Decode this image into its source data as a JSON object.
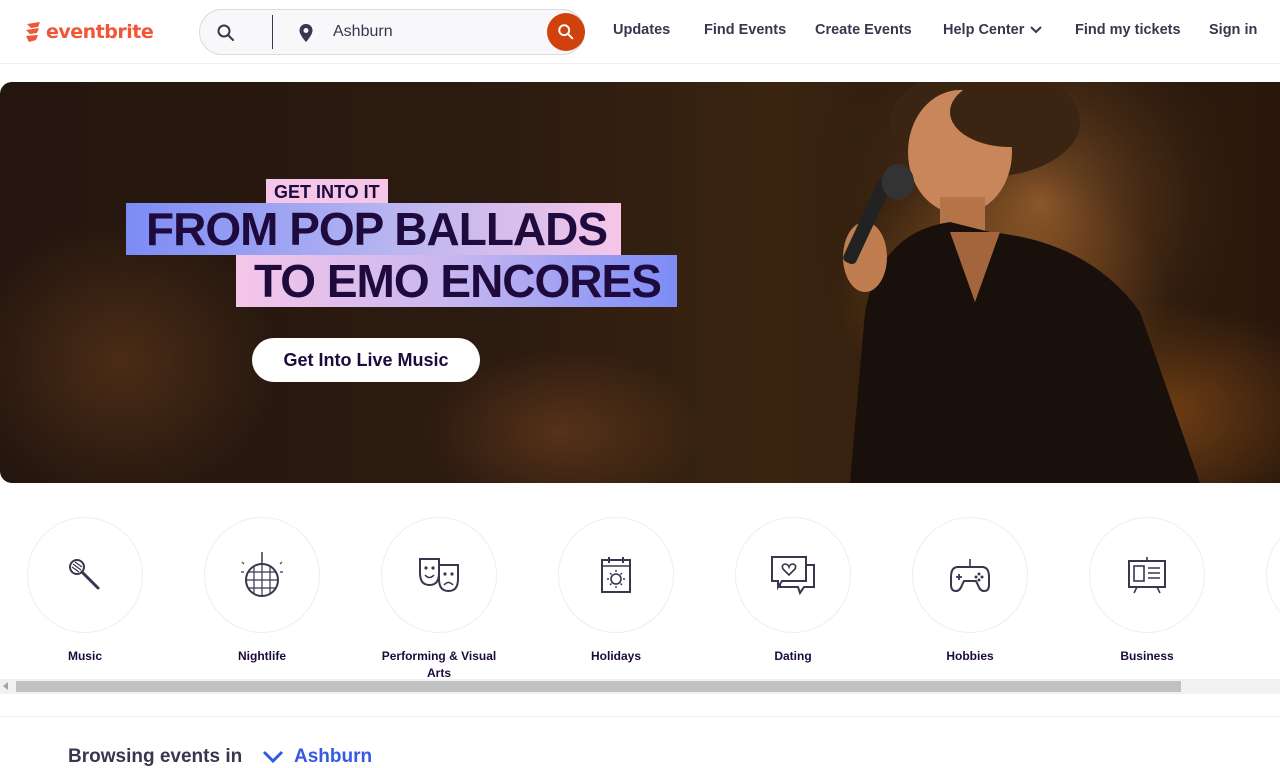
{
  "brand": {
    "name": "eventbrite",
    "color": "#f05537"
  },
  "search": {
    "location": "Ashburn",
    "icon": "search-icon",
    "pin_icon": "location-pin-icon"
  },
  "nav": {
    "updates": "Updates",
    "find_events": "Find Events",
    "create_events": "Create Events",
    "help_center": "Help Center",
    "find_tickets": "Find my tickets",
    "sign_in": "Sign in"
  },
  "hero": {
    "tag": "GET INTO IT",
    "line1": "FROM POP BALLADS",
    "line2": "TO EMO ENCORES",
    "cta": "Get Into Live Music"
  },
  "categories": [
    {
      "label": "Music",
      "icon": "microphone-icon"
    },
    {
      "label": "Nightlife",
      "icon": "disco-ball-icon"
    },
    {
      "label": "Performing & Visual Arts",
      "icon": "theater-masks-icon"
    },
    {
      "label": "Holidays",
      "icon": "calendar-sun-icon"
    },
    {
      "label": "Dating",
      "icon": "chat-heart-icon"
    },
    {
      "label": "Hobbies",
      "icon": "gamepad-icon"
    },
    {
      "label": "Business",
      "icon": "presentation-board-icon"
    }
  ],
  "browse": {
    "prefix": "Browsing events in",
    "location": "Ashburn"
  },
  "colors": {
    "accent": "#d1410c",
    "link": "#3659e3",
    "text": "#1e0a3c"
  }
}
